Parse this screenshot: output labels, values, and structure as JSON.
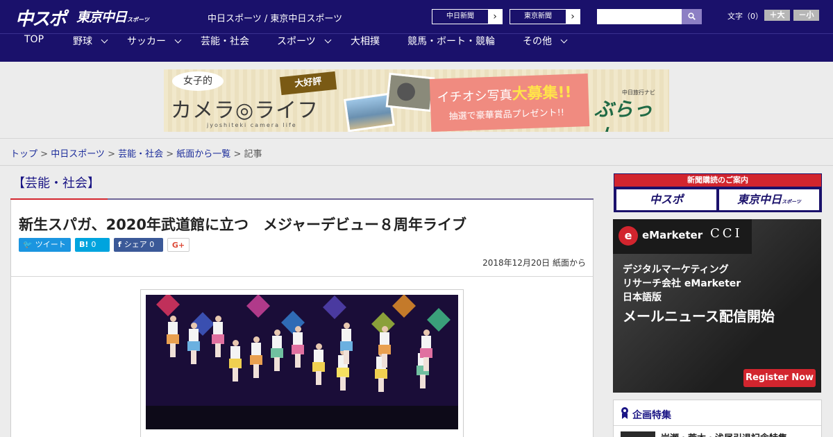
{
  "header": {
    "logo_chuspo": "中スポ",
    "logo_tokyo": "東京中日",
    "logo_tokyo_sub": "スポーツ",
    "site_name": "中日スポーツ / 東京中日スポーツ",
    "paper_links": [
      "中日新聞",
      "東京新聞"
    ],
    "search_placeholder": "",
    "fontsize_label": "文字（0）",
    "fontsize_up": "＋大",
    "fontsize_down": "－小"
  },
  "nav": {
    "items": [
      {
        "label": "TOP",
        "has_menu": false
      },
      {
        "label": "野球",
        "has_menu": true
      },
      {
        "label": "サッカー",
        "has_menu": true
      },
      {
        "label": "芸能・社会",
        "has_menu": false
      },
      {
        "label": "スポーツ",
        "has_menu": true
      },
      {
        "label": "大相撲",
        "has_menu": false
      },
      {
        "label": "競馬・ボート・競輪",
        "has_menu": false
      },
      {
        "label": "その他",
        "has_menu": true
      }
    ]
  },
  "banner": {
    "bubble": "女子的",
    "title": "カメラ◎ライフ",
    "sub": "jyoshiteki camera life",
    "tag": "大好評",
    "promo_line1_pre": "イチオシ写真",
    "promo_line1_big": "大募集!!",
    "promo_line2": "抽選で豪華賞品プレゼント!!",
    "brand_small": "中日旅行ナビ",
    "brand": "ぶらっ人"
  },
  "breadcrumb": {
    "items": [
      "トップ",
      "中日スポーツ",
      "芸能・社会",
      "紙面から一覧"
    ],
    "current": "記事",
    "sep": " > "
  },
  "article": {
    "category": "【芸能・社会】",
    "headline": "新生スパガ、2020年武道館に立つ　メジャーデビュー８周年ライブ",
    "share": {
      "tweet": "ツイート",
      "hatena_icon": "B!",
      "hatena_count": "0",
      "facebook_icon": "f",
      "facebook_label": "シェア",
      "facebook_count": "0",
      "gplus": "G+"
    },
    "dateline": "2018年12月20日 紙面から"
  },
  "sidebar": {
    "subscribe_title": "新聞購読のご案内",
    "subscribe_logos": [
      "中スポ",
      "東京中日"
    ],
    "subscribe_logo_sub": "スポーツ",
    "ad": {
      "brand": "eMarketer",
      "partner": "CCI",
      "line1": "デジタルマーケティング",
      "line2": "リサーチ会社 eMarketer",
      "line3": "日本語版",
      "big": "メールニュース配信開始",
      "button": "Register Now"
    },
    "feature_title": "企画特集",
    "feature_item": "岩瀬・荒木・浅尾引退記念特集"
  },
  "colors": {
    "header_bg": "#1a116b",
    "accent_red": "#d2252e",
    "link": "#1a2b9a"
  }
}
